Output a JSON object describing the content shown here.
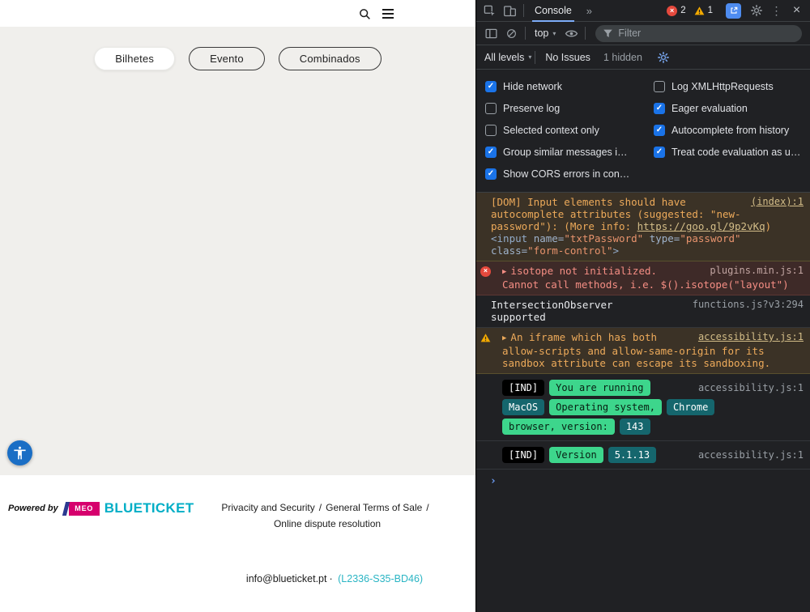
{
  "page": {
    "category_tabs": [
      {
        "label": "Bilhetes",
        "active": true
      },
      {
        "label": "Evento",
        "active": false
      },
      {
        "label": "Combinados",
        "active": false
      }
    ],
    "footer": {
      "powered_by": "Powered by",
      "brand_meo": "MEO",
      "brand_name": "BLUETICKET",
      "links": [
        "Privacity and Security",
        "General Terms of Sale",
        "Online dispute resolution"
      ],
      "separator": "/",
      "email": "info@blueticket.pt",
      "dot": "·",
      "venue_code": "(L2336-S35-BD46)"
    },
    "colors": {
      "brand_teal": "#00aec6",
      "meo_magenta": "#d6006d",
      "accessibility_blue": "#1a6ec5"
    }
  },
  "devtools": {
    "icons": {
      "close": "×",
      "kebab": "⋮",
      "more_tabs": "»",
      "prompt_chevron": "›",
      "expand_arrow": "▶",
      "check": "✓",
      "error_x": "×",
      "caret": "▾"
    },
    "tabbar": {
      "console_tab": "Console",
      "error_count": "2",
      "warning_count": "1"
    },
    "toolbar": {
      "context": "top",
      "filter_placeholder": "Filter"
    },
    "statusbar": {
      "levels": "All levels",
      "no_issues": "No Issues",
      "hidden": "1 hidden"
    },
    "settings": {
      "left": [
        {
          "label": "Hide network",
          "checked": true
        },
        {
          "label": "Preserve log",
          "checked": false
        },
        {
          "label": "Selected context only",
          "checked": false
        },
        {
          "label": "Group similar messages i…",
          "checked": true
        },
        {
          "label": "Show CORS errors in con…",
          "checked": true
        }
      ],
      "right": [
        {
          "label": "Log XMLHttpRequests",
          "checked": false
        },
        {
          "label": "Eager evaluation",
          "checked": true
        },
        {
          "label": "Autocomplete from history",
          "checked": true
        },
        {
          "label": "Treat code evaluation as u…",
          "checked": true
        }
      ]
    },
    "messages": {
      "dom": {
        "source": "(index):1",
        "text": "[DOM] Input elements should have autocomplete attributes (suggested: \"new-password\"): (More info: ",
        "link": "https://goo.gl/9p2vKq",
        "close": ")",
        "preview": [
          {
            "t": "<input "
          },
          {
            "t": "name="
          },
          {
            "t": "\"txtPassword\""
          },
          {
            "t": " type="
          },
          {
            "t": "\"password\""
          },
          {
            "t": " class="
          },
          {
            "t": "\"form-control\""
          },
          {
            "t": ">"
          }
        ]
      },
      "isotope": {
        "text": "isotope not initialized. Cannot call methods, i.e. $().isotope(\"layout\")",
        "source": "plugins.min.js:1"
      },
      "intersection": {
        "text": "IntersectionObserver supported",
        "source": "functions.js?v3:294"
      },
      "iframe": {
        "text": "An iframe which has both allow-scripts and allow-same-origin for its sandbox attribute can escape its sandboxing.",
        "source": "accessibility.js:1"
      },
      "ind1": {
        "prefix": "[IND]",
        "source": "accessibility.js:1",
        "badges": [
          {
            "text": "You are running",
            "style": "green"
          },
          {
            "text": "MacOS",
            "style": "teal"
          },
          {
            "text": "Operating system,",
            "style": "green"
          },
          {
            "text": "Chrome",
            "style": "teal"
          },
          {
            "text": "browser, version:",
            "style": "green"
          },
          {
            "text": "143",
            "style": "teal"
          }
        ]
      },
      "ind2": {
        "prefix": "[IND]",
        "source": "accessibility.js:1",
        "badges": [
          {
            "text": "Version",
            "style": "green"
          },
          {
            "text": "5.1.13",
            "style": "teal"
          }
        ]
      }
    }
  }
}
